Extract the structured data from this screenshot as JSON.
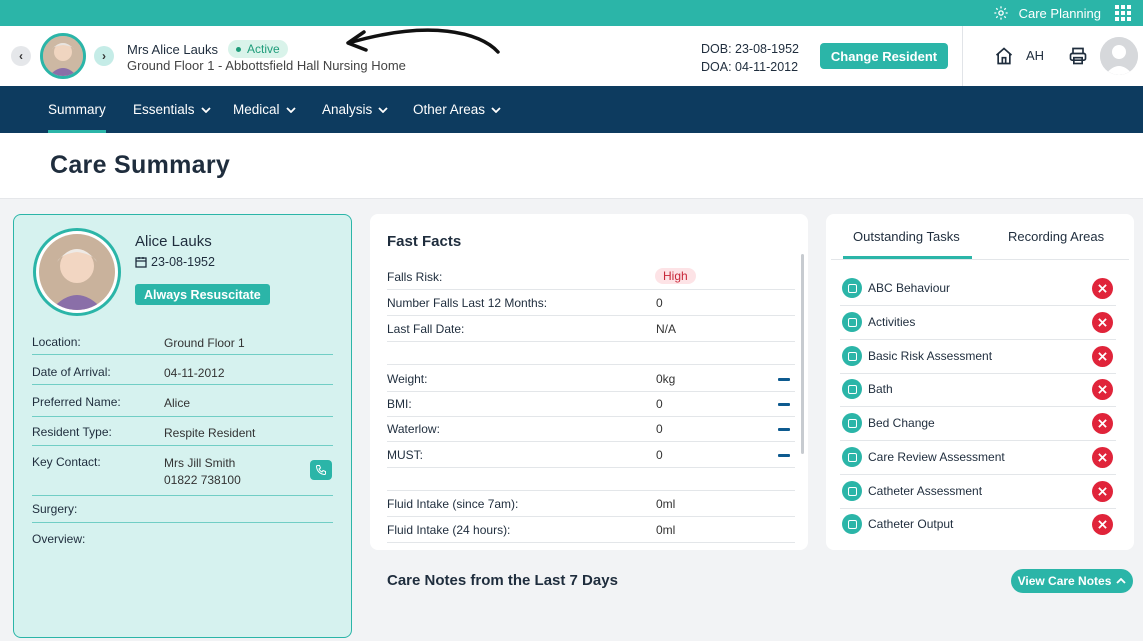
{
  "topbar": {
    "app_label": "Care Planning",
    "icons": [
      "gear-icon",
      "apps-grid-icon"
    ]
  },
  "header": {
    "resident_name": "Mrs Alice Lauks",
    "status": "Active",
    "location": "Ground Floor 1 - Abbottsfield Hall Nursing Home",
    "dob": "DOB: 23-08-1952",
    "doa": "DOA: 04-11-2012",
    "change_button": "Change Resident",
    "user_initials": "AH"
  },
  "nav": {
    "items": [
      {
        "label": "Summary",
        "active": true
      },
      {
        "label": "Essentials",
        "active": false
      },
      {
        "label": "Medical",
        "active": false
      },
      {
        "label": "Analysis",
        "active": false
      },
      {
        "label": "Other Areas",
        "active": false
      }
    ]
  },
  "page": {
    "title": "Care Summary"
  },
  "profile": {
    "name": "Alice Lauks",
    "dob": "23-08-1952",
    "resuscitation": "Always Resuscitate",
    "rows": [
      {
        "label": "Location:",
        "value": "Ground Floor 1"
      },
      {
        "label": "Date of Arrival:",
        "value": "04-11-2012"
      },
      {
        "label": "Preferred Name:",
        "value": "Alice"
      },
      {
        "label": "Resident Type:",
        "value": "Respite Resident"
      },
      {
        "label": "Key Contact:",
        "value": "Mrs Jill Smith",
        "value2": "01822 738100"
      },
      {
        "label": "Surgery:",
        "value": ""
      },
      {
        "label": "Overview:",
        "value": ""
      }
    ]
  },
  "fast_facts": {
    "title": "Fast Facts",
    "falls_risk": {
      "label": "Falls Risk:",
      "value": "High"
    },
    "rows": [
      {
        "label": "Number Falls Last 12 Months:",
        "value": "0"
      },
      {
        "label": "Last Fall Date:",
        "value": "N/A"
      },
      {
        "label": "Weight:",
        "value": "0kg"
      },
      {
        "label": "BMI:",
        "value": "0"
      },
      {
        "label": "Waterlow:",
        "value": "0"
      },
      {
        "label": "MUST:",
        "value": "0"
      },
      {
        "label": "Fluid Intake (since 7am):",
        "value": "0ml"
      },
      {
        "label": "Fluid Intake (24 hours):",
        "value": "0ml"
      }
    ]
  },
  "tasks": {
    "tabs": [
      "Outstanding Tasks",
      "Recording Areas"
    ],
    "items": [
      "ABC Behaviour",
      "Activities",
      "Basic Risk Assessment",
      "Bath",
      "Bed Change",
      "Care Review Assessment",
      "Catheter Assessment",
      "Catheter Output"
    ]
  },
  "care_notes": {
    "title": "Care Notes from the Last 7 Days",
    "button": "View Care Notes"
  },
  "colors": {
    "accent": "#2bb5a8",
    "navy": "#0d3b5f",
    "danger": "#e0243a"
  }
}
